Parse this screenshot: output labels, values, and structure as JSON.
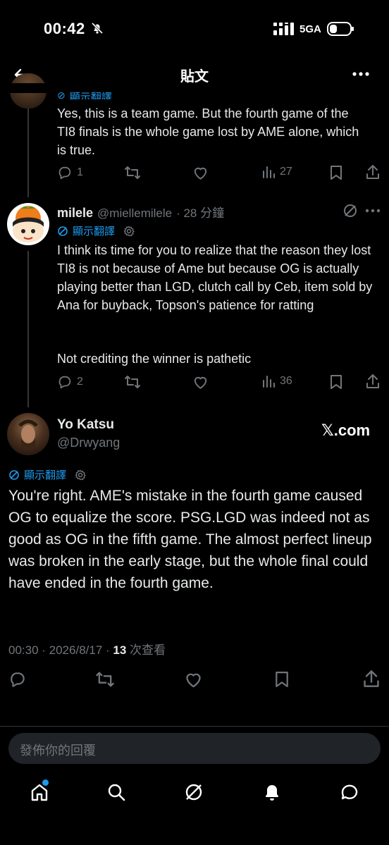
{
  "status": {
    "time": "00:42",
    "network": "5GA"
  },
  "header": {
    "title": "貼文"
  },
  "reply_prev": {
    "translate_label": "顯示翻譯",
    "text": "Yes, this is a team game. But the fourth game of the TI8 finals is the whole game lost by AME alone, which is true.",
    "replies": "1",
    "views": "27"
  },
  "reply_milele": {
    "name": "milele",
    "handle": "@miellemilele",
    "time": "· 28 分鐘",
    "translate_label": "顯示翻譯",
    "text1": "I think its time for you to realize that the reason they lost TI8 is not because of Ame but because OG is actually playing better than LGD, clutch call by Ceb, item sold by Ana for buyback, Topson's patience for ratting",
    "text2": "Not crediting the winner is pathetic",
    "replies": "2",
    "views": "36"
  },
  "main_post": {
    "name": "Yo Katsu",
    "handle": "@Drwyang",
    "source_badge": "𝕏.com",
    "translate_label": "顯示翻譯",
    "text": "You're right. AME's mistake in the fourth game caused OG to equalize the score. PSG.LGD was indeed not as good as OG in the fifth game. The almost perfect lineup was broken in the early stage, but the whole final could have ended in the fourth game.",
    "timestamp": "00:30 · 2026/8/17 · ",
    "views_count": "13",
    "views_label": " 次查看"
  },
  "reply_input": {
    "placeholder": "發佈你的回覆"
  },
  "colors": {
    "accent": "#1d9bf0",
    "muted": "#71767b",
    "text": "#e7e9ea",
    "bg": "#000000"
  }
}
